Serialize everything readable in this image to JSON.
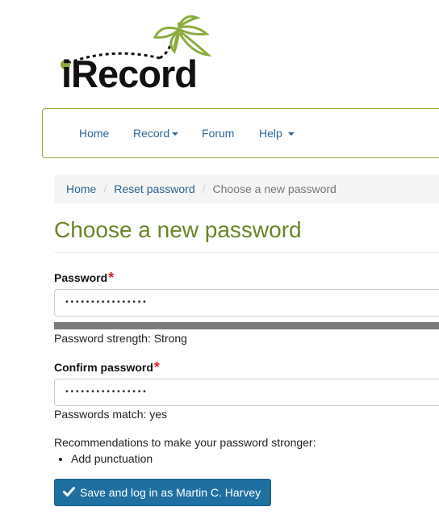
{
  "logo": {
    "text": "iRecord",
    "brand_color": "#8cab3e"
  },
  "nav": {
    "items": [
      {
        "label": "Home",
        "has_caret": false
      },
      {
        "label": "Record",
        "has_caret": true
      },
      {
        "label": "Forum",
        "has_caret": false
      },
      {
        "label": "Help",
        "has_caret": true
      }
    ]
  },
  "breadcrumb": {
    "items": [
      "Home",
      "Reset password",
      "Choose a new password"
    ],
    "separator": "/"
  },
  "page": {
    "title": "Choose a new password"
  },
  "form": {
    "password": {
      "label": "Password",
      "required_mark": "*",
      "value": "••••••••••••••••",
      "strength_text": "Password strength: Strong",
      "strength_fill": 1.0
    },
    "confirm": {
      "label": "Confirm password",
      "required_mark": "*",
      "value": "••••••••••••••••",
      "match_text": "Passwords match: yes"
    },
    "recommendations_title": "Recommendations to make your password stronger:",
    "recommendations": [
      "Add punctuation"
    ],
    "submit_label": "Save and log in as Martin C. Harvey",
    "submit_icon": "check-icon"
  },
  "colors": {
    "title_green": "#6b8427",
    "link_blue": "#2a6496",
    "button_blue": "#1f6fa1",
    "required_red": "#d9232d"
  }
}
